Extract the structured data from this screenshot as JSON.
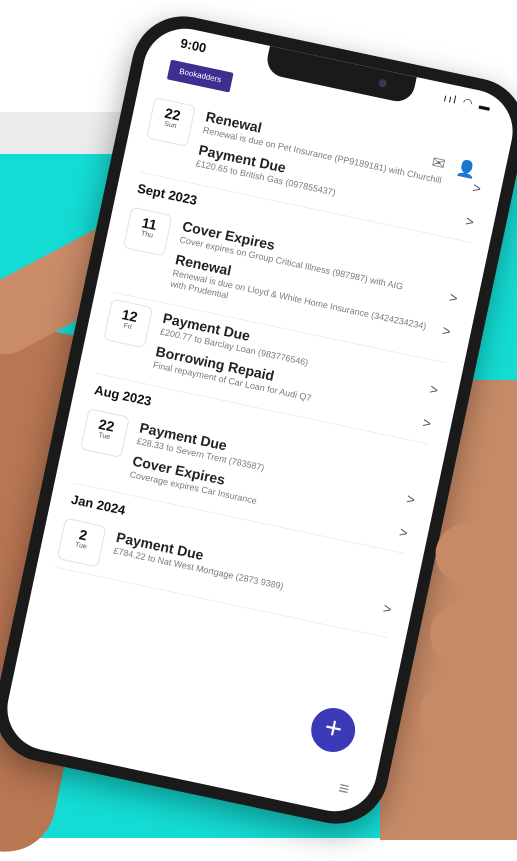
{
  "status": {
    "time": "9:00",
    "icons": "ııl ◠ ▬"
  },
  "app": {
    "logo_text": "Bookadders"
  },
  "feed": [
    {
      "month": "",
      "days": [
        {
          "num": "22",
          "weekday": "Sun",
          "events": [
            {
              "title": "Renewal",
              "desc": "Renewal is due on Pet Insurance (PP9189181) with Churchill"
            },
            {
              "title": "Payment Due",
              "desc": "£120.65 to British Gas (097855437)"
            }
          ]
        }
      ]
    },
    {
      "month": "Sept 2023",
      "days": [
        {
          "num": "11",
          "weekday": "Thu",
          "events": [
            {
              "title": "Cover Expires",
              "desc": "Cover expires on Group Critical Illness (987987) with AIG"
            },
            {
              "title": "Renewal",
              "desc": "Renewal is due on Lloyd & White Home Insurance (3424234234) with Prudential"
            }
          ]
        },
        {
          "num": "12",
          "weekday": "Fri",
          "events": [
            {
              "title": "Payment Due",
              "desc": "£200.77 to Barclay Loan (983776546)"
            },
            {
              "title": "Borrowing Repaid",
              "desc": "Final repayment of Car Loan for Audi Q7"
            }
          ]
        }
      ]
    },
    {
      "month": "Aug 2023",
      "days": [
        {
          "num": "22",
          "weekday": "Tue",
          "events": [
            {
              "title": "Payment Due",
              "desc": "£28.33 to Severn Trent (783587)"
            },
            {
              "title": "Cover Expires",
              "desc": "Coverage expires Car Insurance"
            }
          ]
        }
      ]
    },
    {
      "month": "Jan 2024",
      "days": [
        {
          "num": "2",
          "weekday": "Tue",
          "events": [
            {
              "title": "Payment Due",
              "desc": "£784.22 to Nat West Mortgage (2873 9389)"
            }
          ]
        }
      ]
    }
  ],
  "icons": {
    "mail": "mail-icon",
    "user": "user-icon",
    "chevron": "chevron-right-icon",
    "add": "plus-icon",
    "menu": "hamburger-icon"
  },
  "glyphs": {
    "mail": "✉",
    "user": "👤",
    "chevron": ">",
    "add": "+",
    "menu": "≡"
  },
  "colors": {
    "teal": "#14dcd4",
    "brand_purple": "#3b39b8",
    "logo_purple": "#3f2d8f"
  }
}
